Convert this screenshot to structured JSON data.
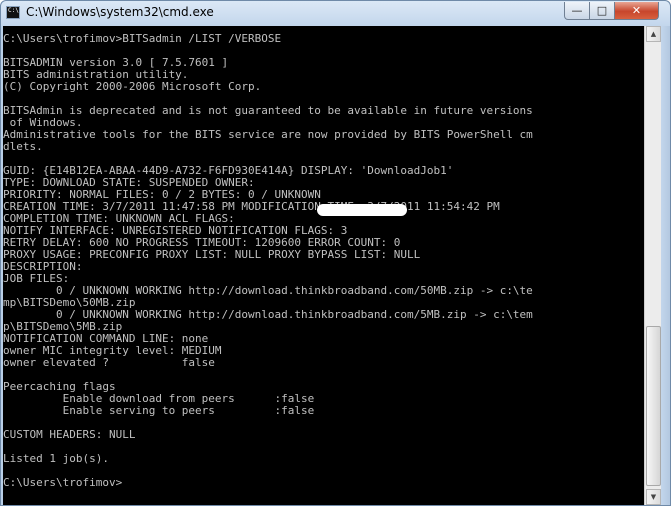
{
  "window": {
    "title": "C:\\Windows\\system32\\cmd.exe",
    "icon_label": "C:\\",
    "buttons": {
      "minimize": "—",
      "maximize": "□",
      "close": "✕"
    }
  },
  "console": {
    "text": "C:\\Users\\trofimov>BITSadmin /LIST /VERBOSE\n\nBITSADMIN version 3.0 [ 7.5.7601 ]\nBITS administration utility.\n(C) Copyright 2000-2006 Microsoft Corp.\n\nBITSAdmin is deprecated and is not guaranteed to be available in future versions\n of Windows.\nAdministrative tools for the BITS service are now provided by BITS PowerShell cm\ndlets.\n\nGUID: {E14B12EA-ABAA-44D9-A732-F6FD930E414A} DISPLAY: 'DownloadJob1'\nTYPE: DOWNLOAD STATE: SUSPENDED OWNER: \nPRIORITY: NORMAL FILES: 0 / 2 BYTES: 0 / UNKNOWN\nCREATION TIME: 3/7/2011 11:47:58 PM MODIFICATION TIME: 3/7/2011 11:54:42 PM\nCOMPLETION TIME: UNKNOWN ACL FLAGS:\nNOTIFY INTERFACE: UNREGISTERED NOTIFICATION FLAGS: 3\nRETRY DELAY: 600 NO PROGRESS TIMEOUT: 1209600 ERROR COUNT: 0\nPROXY USAGE: PRECONFIG PROXY LIST: NULL PROXY BYPASS LIST: NULL\nDESCRIPTION:\nJOB FILES:\n        0 / UNKNOWN WORKING http://download.thinkbroadband.com/50MB.zip -> c:\\te\nmp\\BITSDemo\\50MB.zip\n        0 / UNKNOWN WORKING http://download.thinkbroadband.com/5MB.zip -> c:\\tem\np\\BITSDemo\\5MB.zip\nNOTIFICATION COMMAND LINE: none\nowner MIC integrity level: MEDIUM\nowner elevated ?           false\n\nPeercaching flags\n         Enable download from peers      :false\n         Enable serving to peers         :false\n\nCUSTOM HEADERS: NULL\n\nListed 1 job(s).\n\nC:\\Users\\trofimov>"
  }
}
